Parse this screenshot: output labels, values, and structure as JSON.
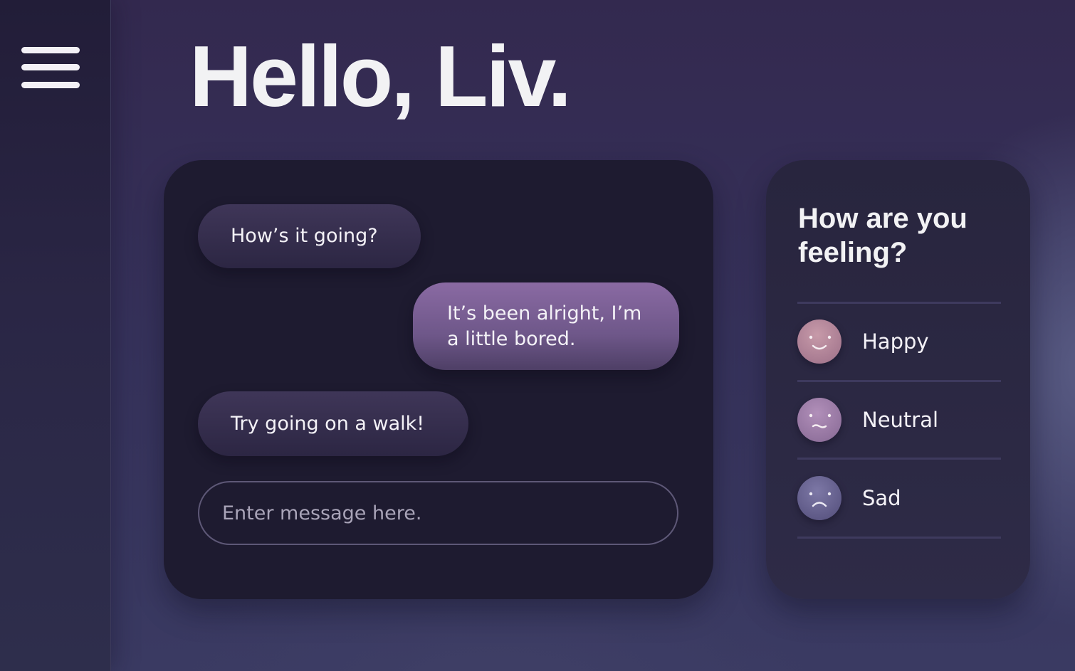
{
  "greeting": "Hello, Liv.",
  "chat": {
    "messages": [
      {
        "sender": "bot",
        "text": "How’s it going?"
      },
      {
        "sender": "user",
        "text": "It’s been alright, I’m a little bored."
      },
      {
        "sender": "bot",
        "text": "Try going on a walk!"
      }
    ],
    "input": {
      "value": "",
      "placeholder": "Enter message here."
    }
  },
  "mood": {
    "title": "How are you feeling?",
    "options": [
      {
        "label": "Happy",
        "icon": "happy-face-icon",
        "color": "#a97c92"
      },
      {
        "label": "Neutral",
        "icon": "neutral-face-icon",
        "color": "#93749f"
      },
      {
        "label": "Sad",
        "icon": "sad-face-icon",
        "color": "#5f5a87"
      }
    ]
  },
  "sidebar": {
    "menu_icon": "menu-icon"
  }
}
